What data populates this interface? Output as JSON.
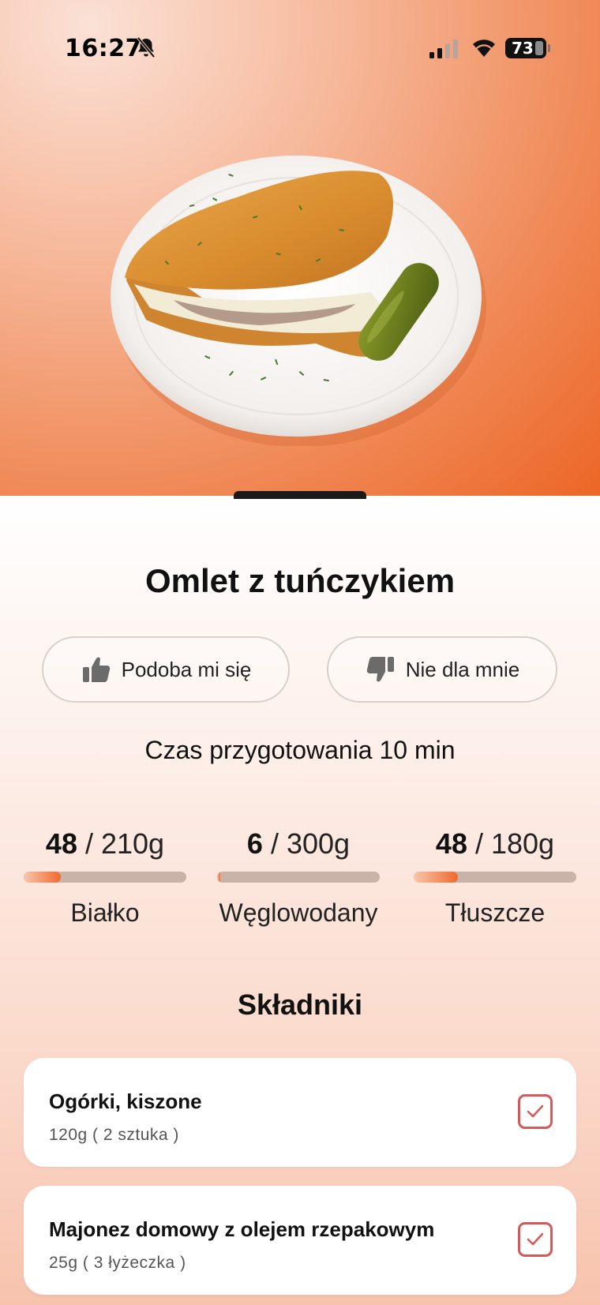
{
  "status": {
    "time": "16:27",
    "battery": "73",
    "icons": [
      "bell-off-icon",
      "signal-icon",
      "wifi-icon",
      "battery-icon"
    ]
  },
  "recipe": {
    "title": "Omlet z tuńczykiem",
    "like_label": "Podoba mi się",
    "dislike_label": "Nie dla mnie",
    "prep_time": "Czas przygotowania 10 min"
  },
  "macros": [
    {
      "value": "48",
      "target": "210g",
      "label": "Białko",
      "progress": 0.23
    },
    {
      "value": "6",
      "target": "300g",
      "label": "Węglowodany",
      "progress": 0.02
    },
    {
      "value": "48",
      "target": "180g",
      "label": "Tłuszcze",
      "progress": 0.27
    }
  ],
  "ingredients_title": "Składniki",
  "ingredients": [
    {
      "name": "Ogórki, kiszone",
      "qty": "120g ( 2 sztuka )",
      "checked": true
    },
    {
      "name": "Majonez domowy z olejem rzepakowym",
      "qty": "25g ( 3 łyżeczka )",
      "checked": true
    }
  ],
  "colors": {
    "accent": "#ef6a2d",
    "check": "#d85858",
    "bar_track": "#c9b2a8"
  }
}
